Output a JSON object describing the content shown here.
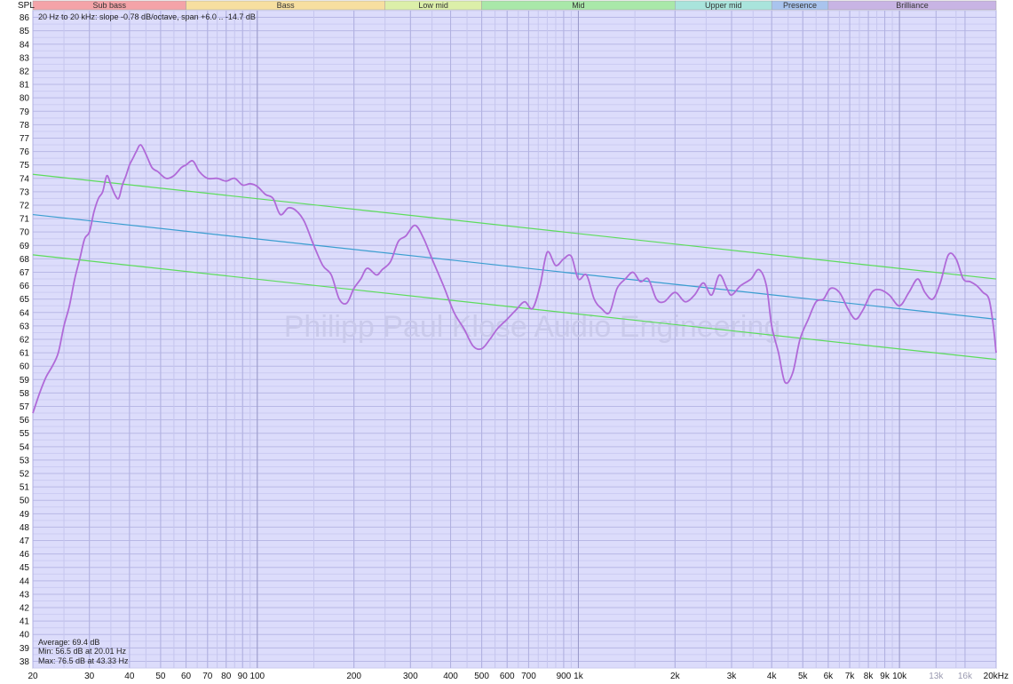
{
  "chart_data": {
    "type": "line",
    "y_axis_label": "SPL",
    "info_line": "20 Hz to 20 kHz: slope -0.78 dB/octave, span +6.0 .. -14.7 dB",
    "watermark": "Philipp Paul Klose Audio Engineering",
    "stats": {
      "average": "Average: 69.4 dB",
      "min": "Min: 56.5 dB at 20.01 Hz",
      "max": "Max: 76.5 dB at 43.33 Hz"
    },
    "xlim": [
      20,
      20000
    ],
    "ylim": [
      37.5,
      86.5
    ],
    "x_scale": "log",
    "x_ticks": [
      {
        "v": 20,
        "label": "20",
        "dim": false
      },
      {
        "v": 30,
        "label": "30",
        "dim": false
      },
      {
        "v": 40,
        "label": "40",
        "dim": false
      },
      {
        "v": 50,
        "label": "50",
        "dim": false
      },
      {
        "v": 60,
        "label": "60",
        "dim": false
      },
      {
        "v": 70,
        "label": "70",
        "dim": false
      },
      {
        "v": 80,
        "label": "80",
        "dim": false
      },
      {
        "v": 90,
        "label": "90",
        "dim": false
      },
      {
        "v": 100,
        "label": "100",
        "dim": false
      },
      {
        "v": 200,
        "label": "200",
        "dim": false
      },
      {
        "v": 300,
        "label": "300",
        "dim": false
      },
      {
        "v": 400,
        "label": "400",
        "dim": false
      },
      {
        "v": 500,
        "label": "500",
        "dim": false
      },
      {
        "v": 600,
        "label": "600",
        "dim": false
      },
      {
        "v": 700,
        "label": "700",
        "dim": false
      },
      {
        "v": 900,
        "label": "900",
        "dim": false
      },
      {
        "v": 1000,
        "label": "1k",
        "dim": false
      },
      {
        "v": 2000,
        "label": "2k",
        "dim": false
      },
      {
        "v": 3000,
        "label": "3k",
        "dim": false
      },
      {
        "v": 4000,
        "label": "4k",
        "dim": false
      },
      {
        "v": 5000,
        "label": "5k",
        "dim": false
      },
      {
        "v": 6000,
        "label": "6k",
        "dim": false
      },
      {
        "v": 7000,
        "label": "7k",
        "dim": false
      },
      {
        "v": 8000,
        "label": "8k",
        "dim": false
      },
      {
        "v": 9000,
        "label": "9k",
        "dim": false
      },
      {
        "v": 10000,
        "label": "10k",
        "dim": false
      },
      {
        "v": 13000,
        "label": "13k",
        "dim": true
      },
      {
        "v": 16000,
        "label": "16k",
        "dim": true
      },
      {
        "v": 20000,
        "label": "20kHz",
        "dim": false
      }
    ],
    "y_ticks": [
      38,
      39,
      40,
      41,
      42,
      43,
      44,
      45,
      46,
      47,
      48,
      49,
      50,
      51,
      52,
      53,
      54,
      55,
      56,
      57,
      58,
      59,
      60,
      61,
      62,
      63,
      64,
      65,
      66,
      67,
      68,
      69,
      70,
      71,
      72,
      73,
      74,
      75,
      76,
      77,
      78,
      79,
      80,
      81,
      82,
      83,
      84,
      85,
      86
    ],
    "bands": [
      {
        "name": "Sub bass",
        "from": 20,
        "to": 60,
        "color": "#f4a3a8"
      },
      {
        "name": "Bass",
        "from": 60,
        "to": 250,
        "color": "#f7dfa0"
      },
      {
        "name": "Low mid",
        "from": 250,
        "to": 500,
        "color": "#dcefa9"
      },
      {
        "name": "Mid",
        "from": 500,
        "to": 2000,
        "color": "#a9e8a9"
      },
      {
        "name": "Upper mid",
        "from": 2000,
        "to": 4000,
        "color": "#a9e4dc"
      },
      {
        "name": "Presence",
        "from": 4000,
        "to": 6000,
        "color": "#a9c4ee"
      },
      {
        "name": "Brilliance",
        "from": 6000,
        "to": 20000,
        "color": "#c8b4e4"
      }
    ],
    "trend_lines": [
      {
        "name": "upper",
        "color": "#5cdc5c",
        "points": [
          [
            20,
            74.3
          ],
          [
            20000,
            66.5
          ]
        ]
      },
      {
        "name": "center",
        "color": "#3a9ed0",
        "points": [
          [
            20,
            71.3
          ],
          [
            20000,
            63.5
          ]
        ]
      },
      {
        "name": "lower",
        "color": "#5cdc5c",
        "points": [
          [
            20,
            68.3
          ],
          [
            20000,
            60.5
          ]
        ]
      }
    ],
    "series": [
      {
        "color": "#b06ad8",
        "points": [
          [
            20,
            56.5
          ],
          [
            21,
            58.0
          ],
          [
            22,
            59.2
          ],
          [
            23,
            60.0
          ],
          [
            24,
            61.0
          ],
          [
            25,
            63.0
          ],
          [
            26,
            64.5
          ],
          [
            27,
            66.5
          ],
          [
            28,
            68.0
          ],
          [
            29,
            69.5
          ],
          [
            30,
            70.0
          ],
          [
            31,
            71.5
          ],
          [
            32,
            72.5
          ],
          [
            33,
            73.0
          ],
          [
            34,
            74.2
          ],
          [
            35,
            73.5
          ],
          [
            36,
            72.8
          ],
          [
            37,
            72.5
          ],
          [
            38,
            73.5
          ],
          [
            39,
            74.2
          ],
          [
            40,
            75.0
          ],
          [
            41,
            75.5
          ],
          [
            42,
            76.0
          ],
          [
            43.33,
            76.5
          ],
          [
            45,
            75.8
          ],
          [
            47,
            74.8
          ],
          [
            49,
            74.5
          ],
          [
            52,
            74.0
          ],
          [
            55,
            74.2
          ],
          [
            58,
            74.8
          ],
          [
            60,
            75.0
          ],
          [
            63,
            75.3
          ],
          [
            66,
            74.5
          ],
          [
            70,
            74.0
          ],
          [
            75,
            74.0
          ],
          [
            80,
            73.8
          ],
          [
            85,
            74.0
          ],
          [
            90,
            73.5
          ],
          [
            95,
            73.6
          ],
          [
            100,
            73.4
          ],
          [
            106,
            72.8
          ],
          [
            112,
            72.5
          ],
          [
            118,
            71.3
          ],
          [
            125,
            71.8
          ],
          [
            132,
            71.6
          ],
          [
            140,
            70.8
          ],
          [
            150,
            69.0
          ],
          [
            160,
            67.5
          ],
          [
            170,
            66.8
          ],
          [
            180,
            65.0
          ],
          [
            190,
            64.7
          ],
          [
            200,
            65.8
          ],
          [
            210,
            66.5
          ],
          [
            220,
            67.3
          ],
          [
            235,
            66.8
          ],
          [
            245,
            67.2
          ],
          [
            260,
            67.8
          ],
          [
            275,
            69.3
          ],
          [
            290,
            69.7
          ],
          [
            310,
            70.5
          ],
          [
            330,
            69.5
          ],
          [
            350,
            68.0
          ],
          [
            380,
            66.0
          ],
          [
            410,
            64.0
          ],
          [
            440,
            62.8
          ],
          [
            470,
            61.5
          ],
          [
            500,
            61.3
          ],
          [
            530,
            62.0
          ],
          [
            560,
            62.8
          ],
          [
            600,
            63.5
          ],
          [
            640,
            64.2
          ],
          [
            680,
            64.8
          ],
          [
            720,
            64.3
          ],
          [
            760,
            66.0
          ],
          [
            800,
            68.5
          ],
          [
            850,
            67.5
          ],
          [
            900,
            68.0
          ],
          [
            950,
            68.2
          ],
          [
            1000,
            66.5
          ],
          [
            1060,
            66.8
          ],
          [
            1120,
            65.0
          ],
          [
            1180,
            64.3
          ],
          [
            1250,
            64.0
          ],
          [
            1320,
            65.8
          ],
          [
            1400,
            66.5
          ],
          [
            1480,
            67.0
          ],
          [
            1560,
            66.3
          ],
          [
            1650,
            66.5
          ],
          [
            1750,
            65.0
          ],
          [
            1850,
            64.8
          ],
          [
            2000,
            65.5
          ],
          [
            2150,
            64.8
          ],
          [
            2300,
            65.3
          ],
          [
            2450,
            66.2
          ],
          [
            2600,
            65.3
          ],
          [
            2750,
            66.8
          ],
          [
            2900,
            65.8
          ],
          [
            3000,
            65.3
          ],
          [
            3200,
            66.0
          ],
          [
            3450,
            66.5
          ],
          [
            3650,
            67.2
          ],
          [
            3850,
            66.0
          ],
          [
            4000,
            63.0
          ],
          [
            4200,
            61.0
          ],
          [
            4400,
            58.8
          ],
          [
            4650,
            59.5
          ],
          [
            4900,
            62.0
          ],
          [
            5200,
            63.5
          ],
          [
            5500,
            64.8
          ],
          [
            5800,
            65.0
          ],
          [
            6100,
            65.8
          ],
          [
            6500,
            65.5
          ],
          [
            6900,
            64.3
          ],
          [
            7300,
            63.5
          ],
          [
            7700,
            64.2
          ],
          [
            8200,
            65.5
          ],
          [
            8700,
            65.7
          ],
          [
            9300,
            65.3
          ],
          [
            10000,
            64.5
          ],
          [
            10700,
            65.5
          ],
          [
            11400,
            66.5
          ],
          [
            12000,
            65.5
          ],
          [
            12700,
            65.0
          ],
          [
            13400,
            66.2
          ],
          [
            14200,
            68.3
          ],
          [
            15000,
            68.0
          ],
          [
            15800,
            66.5
          ],
          [
            16600,
            66.3
          ],
          [
            17400,
            66.0
          ],
          [
            18200,
            65.5
          ],
          [
            19000,
            65.0
          ],
          [
            19600,
            63.0
          ],
          [
            20000,
            61.0
          ]
        ]
      }
    ]
  }
}
